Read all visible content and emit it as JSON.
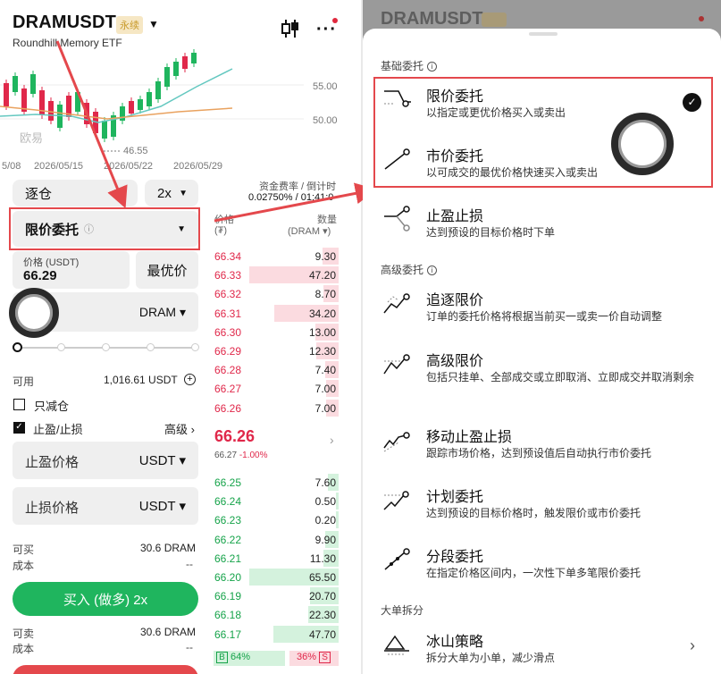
{
  "left": {
    "header": {
      "title": "DRAMUSDT",
      "badge": "永续",
      "subtitle": "Roundhill Memory ETF"
    },
    "chart": {
      "y_ticks": [
        "55.00",
        "50.00"
      ],
      "x_ticks": [
        "5/08",
        "2026/05/15",
        "2026/05/22",
        "2026/05/29"
      ],
      "low_label": "46.55",
      "watermark": "欧易"
    },
    "margin_mode": "逐仓",
    "leverage": "2x",
    "funding": {
      "label": "资金费率 / 倒计时",
      "value": "0.02750% / 01:41:0"
    },
    "order_type": {
      "label": "限价委托",
      "info": "i"
    },
    "price": {
      "label": "价格 (USDT)",
      "value": "66.29"
    },
    "best_price": "最优价",
    "qty_unit": "DRAM",
    "available": {
      "label": "可用",
      "value": "1,016.61 USDT"
    },
    "reduce_only": "只减仓",
    "tp_sl": {
      "label": "止盈/止损",
      "advanced": "高级 ›"
    },
    "tp_field": {
      "label": "止盈价格",
      "unit": "USDT"
    },
    "sl_field": {
      "label": "止损价格",
      "unit": "USDT"
    },
    "buy_info": {
      "can_buy": "可买",
      "can_buy_val": "30.6 DRAM",
      "cost": "成本",
      "cost_val": "--"
    },
    "buy_button": "买入 (做多) 2x",
    "sell_info": {
      "can_sell": "可卖",
      "can_sell_val": "30.6 DRAM",
      "cost": "成本",
      "cost_val": "--"
    },
    "orderbook": {
      "col_price": "价格",
      "col_price_unit": "(₮)",
      "col_qty": "数量",
      "col_qty_unit": "(DRAM ▾)",
      "asks": [
        {
          "p": "66.34",
          "q": "9.30",
          "w": 0.18
        },
        {
          "p": "66.33",
          "q": "47.20",
          "w": 1.0
        },
        {
          "p": "66.32",
          "q": "8.70",
          "w": 0.17
        },
        {
          "p": "66.31",
          "q": "34.20",
          "w": 0.72
        },
        {
          "p": "66.30",
          "q": "13.00",
          "w": 0.26
        },
        {
          "p": "66.29",
          "q": "12.30",
          "w": 0.25
        },
        {
          "p": "66.28",
          "q": "7.40",
          "w": 0.15
        },
        {
          "p": "66.27",
          "q": "7.00",
          "w": 0.14
        },
        {
          "p": "66.26",
          "q": "7.00",
          "w": 0.14
        }
      ],
      "mid": {
        "price": "66.26",
        "ref": "66.27",
        "change": "-1.00%"
      },
      "bids": [
        {
          "p": "66.25",
          "q": "7.60",
          "w": 0.12
        },
        {
          "p": "66.24",
          "q": "0.50",
          "w": 0.01
        },
        {
          "p": "66.23",
          "q": "0.20",
          "w": 0.01
        },
        {
          "p": "66.22",
          "q": "9.90",
          "w": 0.15
        },
        {
          "p": "66.21",
          "q": "11.30",
          "w": 0.17
        },
        {
          "p": "66.20",
          "q": "65.50",
          "w": 1.0
        },
        {
          "p": "66.19",
          "q": "20.70",
          "w": 0.32
        },
        {
          "p": "66.18",
          "q": "22.30",
          "w": 0.34
        },
        {
          "p": "66.17",
          "q": "47.70",
          "w": 0.73
        }
      ],
      "buy_ratio": "64%",
      "sell_ratio": "36%",
      "b_tag": "B",
      "s_tag": "S"
    }
  },
  "right": {
    "header_title": "DRAMUSDT",
    "section_basic": "基础委托",
    "section_adv": "高级委托",
    "section_big": "大单拆分",
    "items": [
      {
        "title": "限价委托",
        "desc": "以指定或更优价格买入或卖出"
      },
      {
        "title": "市价委托",
        "desc": "以可成交的最优价格快速买入或卖出"
      },
      {
        "title": "止盈止损",
        "desc": "达到预设的目标价格时下单"
      },
      {
        "title": "追逐限价",
        "desc": "订单的委托价格将根据当前买一或卖一价自动调整"
      },
      {
        "title": "高级限价",
        "desc": "包括只挂单、全部成交或立即取消、立即成交并取消剩余"
      },
      {
        "title": "移动止盈止损",
        "desc": "跟踪市场价格，达到预设值后自动执行市价委托"
      },
      {
        "title": "计划委托",
        "desc": "达到预设的目标价格时，触发限价或市价委托"
      },
      {
        "title": "分段委托",
        "desc": "在指定价格区间内，一次性下单多笔限价委托"
      },
      {
        "title": "冰山策略",
        "desc": "拆分大单为小单，减少滑点"
      }
    ]
  },
  "colors": {
    "ask": "#e0284a",
    "bid": "#16a34a",
    "highlight": "#e4484c",
    "buy": "#1fb55e"
  }
}
